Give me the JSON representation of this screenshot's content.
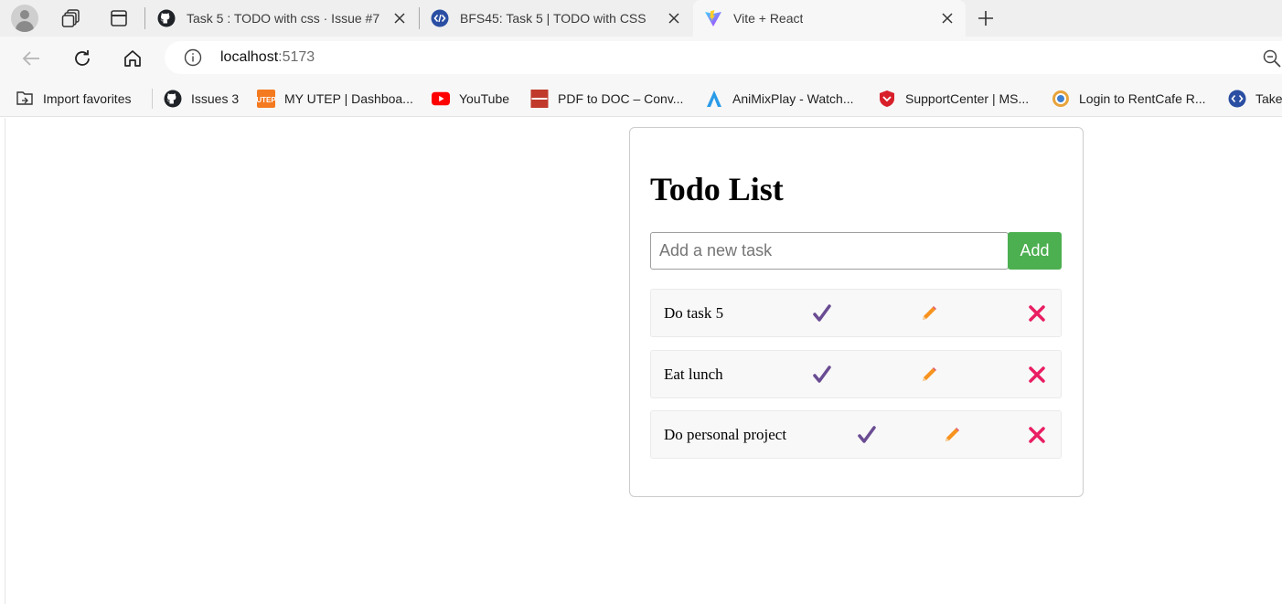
{
  "browser": {
    "tabs": [
      {
        "title": "Task 5 : TODO with css · Issue #7",
        "favicon": "github-icon",
        "active": false
      },
      {
        "title": "BFS45: Task 5 | TODO with CSS",
        "favicon": "code-brackets-icon",
        "active": false
      },
      {
        "title": "Vite + React",
        "favicon": "vite-icon",
        "active": true
      }
    ],
    "address": {
      "host": "localhost",
      "port": ":5173"
    },
    "bookmarks": [
      {
        "label": "Import favorites",
        "icon": "import-icon"
      },
      {
        "label": "Issues 3",
        "icon": "github-icon"
      },
      {
        "label": "MY UTEP | Dashboa...",
        "icon": "utep-icon"
      },
      {
        "label": "YouTube",
        "icon": "youtube-icon"
      },
      {
        "label": "PDF to DOC – Conv...",
        "icon": "pdf-doc-icon"
      },
      {
        "label": "AniMixPlay - Watch...",
        "icon": "animixplay-icon"
      },
      {
        "label": "SupportCenter | MS...",
        "icon": "shield-icon"
      },
      {
        "label": "Login to RentCafe R...",
        "icon": "rentcafe-icon"
      },
      {
        "label": "Take",
        "icon": "code-brackets-icon"
      }
    ]
  },
  "app": {
    "title": "Todo List",
    "input": {
      "placeholder": "Add a new task",
      "value": ""
    },
    "add_label": "Add",
    "todos": [
      {
        "text": "Do task 5"
      },
      {
        "text": "Eat lunch"
      },
      {
        "text": "Do personal project"
      }
    ],
    "colors": {
      "add_button": "#4caf50",
      "check": "#6a4c93",
      "edit": "#f7931e",
      "delete": "#e91e63"
    }
  }
}
